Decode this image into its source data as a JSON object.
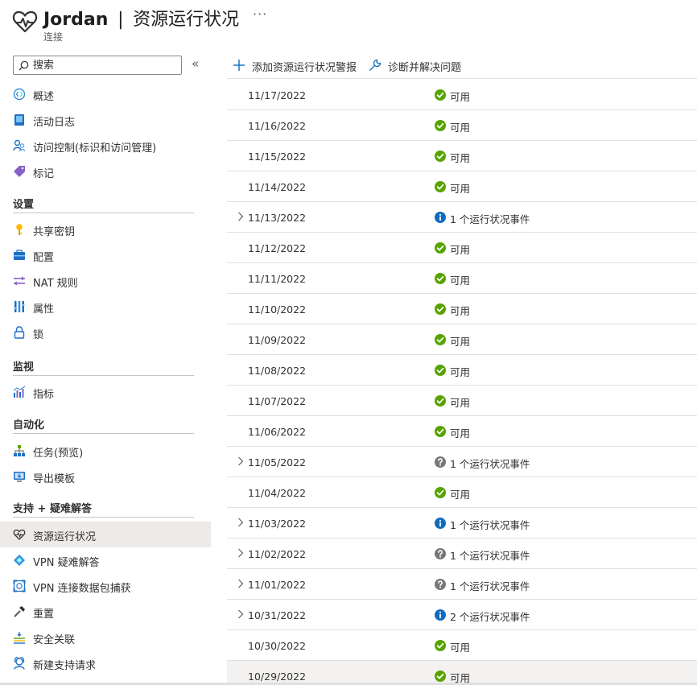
{
  "header": {
    "resource_name": "Jordan",
    "separator": "|",
    "blade_title": "资源运行状况",
    "more": "···",
    "subtitle": "连接"
  },
  "sidebar": {
    "search_placeholder": "搜索",
    "collapse": "«",
    "top_items": [
      {
        "label": "概述",
        "icon": "overview-icon"
      },
      {
        "label": "活动日志",
        "icon": "activity-log-icon"
      },
      {
        "label": "访问控制(标识和访问管理)",
        "icon": "access-control-icon"
      },
      {
        "label": "标记",
        "icon": "tag-icon"
      }
    ],
    "sections": [
      {
        "title": "设置",
        "items": [
          {
            "label": "共享密钥",
            "icon": "key-icon"
          },
          {
            "label": "配置",
            "icon": "configuration-icon"
          },
          {
            "label": "NAT 规则",
            "icon": "nat-rules-icon"
          },
          {
            "label": "属性",
            "icon": "properties-icon"
          },
          {
            "label": "锁",
            "icon": "lock-icon"
          }
        ]
      },
      {
        "title": "监视",
        "items": [
          {
            "label": "指标",
            "icon": "metrics-icon"
          }
        ]
      },
      {
        "title": "自动化",
        "items": [
          {
            "label": "任务(预览)",
            "icon": "tasks-icon"
          },
          {
            "label": "导出模板",
            "icon": "export-template-icon"
          }
        ]
      },
      {
        "title": "支持 + 疑难解答",
        "items": [
          {
            "label": "资源运行状况",
            "icon": "resource-health-icon",
            "selected": true
          },
          {
            "label": "VPN 疑难解答",
            "icon": "vpn-troubleshoot-icon"
          },
          {
            "label": "VPN 连接数据包捕获",
            "icon": "packet-capture-icon"
          },
          {
            "label": "重置",
            "icon": "reset-icon"
          },
          {
            "label": "安全关联",
            "icon": "security-association-icon"
          },
          {
            "label": "新建支持请求",
            "icon": "support-request-icon"
          }
        ]
      }
    ]
  },
  "toolbar": {
    "add_alert_label": "添加资源运行状况警报",
    "diagnose_label": "诊断并解决问题"
  },
  "colors": {
    "available": "#57a300",
    "info": "#0f6cbd",
    "unknown": "#797775",
    "selected_bg": "#edebe9"
  },
  "health_rows": [
    {
      "date": "11/17/2022",
      "status": "可用",
      "kind": "available",
      "expandable": false
    },
    {
      "date": "11/16/2022",
      "status": "可用",
      "kind": "available",
      "expandable": false
    },
    {
      "date": "11/15/2022",
      "status": "可用",
      "kind": "available",
      "expandable": false
    },
    {
      "date": "11/14/2022",
      "status": "可用",
      "kind": "available",
      "expandable": false
    },
    {
      "date": "11/13/2022",
      "status": "1 个运行状况事件",
      "kind": "info",
      "expandable": true
    },
    {
      "date": "11/12/2022",
      "status": "可用",
      "kind": "available",
      "expandable": false
    },
    {
      "date": "11/11/2022",
      "status": "可用",
      "kind": "available",
      "expandable": false
    },
    {
      "date": "11/10/2022",
      "status": "可用",
      "kind": "available",
      "expandable": false
    },
    {
      "date": "11/09/2022",
      "status": "可用",
      "kind": "available",
      "expandable": false
    },
    {
      "date": "11/08/2022",
      "status": "可用",
      "kind": "available",
      "expandable": false
    },
    {
      "date": "11/07/2022",
      "status": "可用",
      "kind": "available",
      "expandable": false
    },
    {
      "date": "11/06/2022",
      "status": "可用",
      "kind": "available",
      "expandable": false
    },
    {
      "date": "11/05/2022",
      "status": "1 个运行状况事件",
      "kind": "unknown",
      "expandable": true
    },
    {
      "date": "11/04/2022",
      "status": "可用",
      "kind": "available",
      "expandable": false
    },
    {
      "date": "11/03/2022",
      "status": "1 个运行状况事件",
      "kind": "info",
      "expandable": true
    },
    {
      "date": "11/02/2022",
      "status": "1 个运行状况事件",
      "kind": "unknown",
      "expandable": true
    },
    {
      "date": "11/01/2022",
      "status": "1 个运行状况事件",
      "kind": "unknown",
      "expandable": true
    },
    {
      "date": "10/31/2022",
      "status": "2 个运行状况事件",
      "kind": "info",
      "expandable": true
    },
    {
      "date": "10/30/2022",
      "status": "可用",
      "kind": "available",
      "expandable": false
    },
    {
      "date": "10/29/2022",
      "status": "可用",
      "kind": "available",
      "expandable": false,
      "hover": true
    }
  ]
}
